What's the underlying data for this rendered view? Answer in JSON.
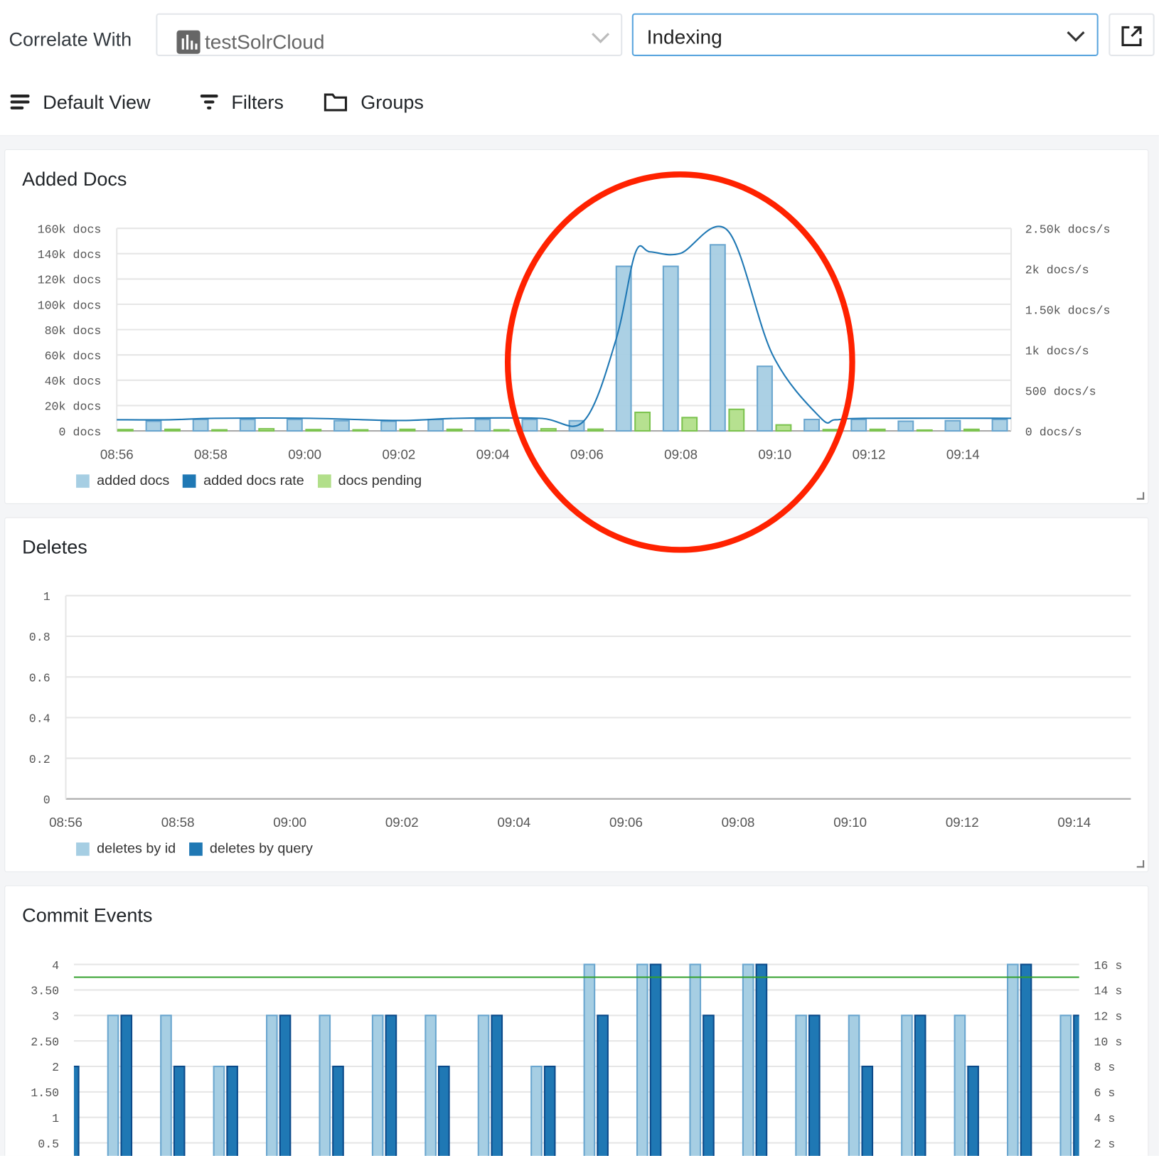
{
  "header": {
    "correlate_label": "Correlate With",
    "source_select": {
      "value": "testSolrCloud",
      "icon": "bar-chart-icon"
    },
    "dashboard_select": {
      "value": "Indexing"
    },
    "external_link_icon": "external-link-icon"
  },
  "toolbar": {
    "default_view": "Default View",
    "filters": "Filters",
    "groups": "Groups"
  },
  "colors": {
    "light_blue": "#a6cee3",
    "dark_blue": "#1f78b4",
    "light_green": "#b2df8a",
    "threshold_green": "#33a02c",
    "annotation_red": "#ff2200",
    "accent_border": "#5aa5de"
  },
  "chart_data": [
    {
      "title": "Added Docs",
      "type": "bar",
      "x_ticks": [
        "08:56",
        "08:58",
        "09:00",
        "09:02",
        "09:04",
        "09:06",
        "09:08",
        "09:10",
        "09:12",
        "09:14"
      ],
      "y_left_ticks": [
        "160k docs",
        "140k docs",
        "120k docs",
        "100k docs",
        "80k docs",
        "60k docs",
        "40k docs",
        "20k docs",
        "0 docs"
      ],
      "y_left_range": [
        0,
        160000
      ],
      "y_right_ticks": [
        "2.50k docs/s",
        "2k docs/s",
        "1.50k docs/s",
        "1k docs/s",
        "500 docs/s",
        "0 docs/s"
      ],
      "y_right_range": [
        0,
        2500
      ],
      "grid": true,
      "legend_placement": "bottom-left",
      "legend": [
        "added docs",
        "added docs rate",
        "docs pending"
      ],
      "series": [
        {
          "name": "added docs",
          "kind": "bar",
          "axis": "left",
          "color": "#a6cee3",
          "x": [
            "08:56:47",
            "08:57:47",
            "08:58:47",
            "08:59:47",
            "09:00:47",
            "09:01:47",
            "09:02:47",
            "09:03:47",
            "09:04:47",
            "09:05:47",
            "09:06:47",
            "09:07:47",
            "09:08:47",
            "09:09:47",
            "09:10:47",
            "09:11:47",
            "09:12:47",
            "09:13:47",
            "09:14:47"
          ],
          "values": [
            7600,
            9000,
            9000,
            9000,
            8000,
            7600,
            9000,
            9000,
            9000,
            8000,
            130000,
            130000,
            147000,
            51000,
            9000,
            9000,
            7600,
            8000,
            9000
          ]
        },
        {
          "name": "docs pending",
          "kind": "bar",
          "axis": "left",
          "color": "#b2df8a",
          "x": [
            "08:56:11",
            "08:57:11",
            "08:58:11",
            "08:59:11",
            "09:00:11",
            "09:01:11",
            "09:02:11",
            "09:03:11",
            "09:04:11",
            "09:05:11",
            "09:06:11",
            "09:07:11",
            "09:08:11",
            "09:09:11",
            "09:10:11",
            "09:11:11",
            "09:12:11",
            "09:13:11",
            "09:14:11"
          ],
          "values": [
            1000,
            1200,
            800,
            1600,
            1000,
            800,
            1200,
            1200,
            800,
            1600,
            1300,
            14600,
            10500,
            17000,
            4700,
            1000,
            1200,
            600,
            1200
          ]
        },
        {
          "name": "added docs rate",
          "kind": "line",
          "axis": "right",
          "color": "#1f78b4",
          "x": [
            "08:56:00",
            "08:57:08",
            "08:58:05",
            "09:00:07",
            "09:02:00",
            "09:03:16",
            "09:05:00",
            "09:05:56",
            "09:06:37",
            "09:07:02",
            "09:07:21",
            "09:07:59",
            "09:09:00",
            "09:09:57",
            "09:10:58",
            "09:11:17",
            "09:11:55",
            "09:15:02"
          ],
          "values": [
            137,
            137,
            155,
            155,
            128,
            155,
            155,
            120,
            1120,
            2200,
            2210,
            2190,
            2470,
            940,
            164,
            137,
            155,
            155
          ]
        }
      ]
    },
    {
      "title": "Deletes",
      "type": "bar",
      "x_ticks": [
        "08:56",
        "08:58",
        "09:00",
        "09:02",
        "09:04",
        "09:06",
        "09:08",
        "09:10",
        "09:12",
        "09:14"
      ],
      "y_ticks": [
        "1",
        "0.8",
        "0.6",
        "0.4",
        "0.2",
        "0"
      ],
      "y_range": [
        0,
        1
      ],
      "grid": true,
      "legend_placement": "bottom-left",
      "legend": [
        "deletes by id",
        "deletes by query"
      ],
      "series": [
        {
          "name": "deletes by id",
          "color": "#a6cee3",
          "values": []
        },
        {
          "name": "deletes by query",
          "color": "#1f78b4",
          "values": []
        }
      ]
    },
    {
      "title": "Commit Events",
      "type": "bar",
      "y_left_ticks": [
        "4",
        "3.50",
        "3",
        "2.50",
        "2",
        "1.50",
        "1",
        "0.5"
      ],
      "y_left_range": [
        0,
        4
      ],
      "y_right_ticks": [
        "16 s",
        "14 s",
        "12 s",
        "10 s",
        "8 s",
        "6 s",
        "4 s",
        "2 s"
      ],
      "y_right_range": [
        0,
        16
      ],
      "grid": true,
      "threshold": 3.75,
      "series": [
        {
          "kind": "bar",
          "color": "#a6cee3",
          "values": [
            null,
            3,
            3,
            2,
            3,
            3,
            3,
            3,
            3,
            2,
            4,
            4,
            4,
            4,
            3,
            3,
            3,
            3,
            4,
            3
          ]
        },
        {
          "kind": "bar",
          "color": "#1f78b4",
          "values": [
            2,
            3,
            2,
            2,
            3,
            2,
            3,
            2,
            3,
            2,
            3,
            4,
            3,
            4,
            3,
            2,
            3,
            2,
            4,
            3
          ]
        }
      ]
    }
  ]
}
